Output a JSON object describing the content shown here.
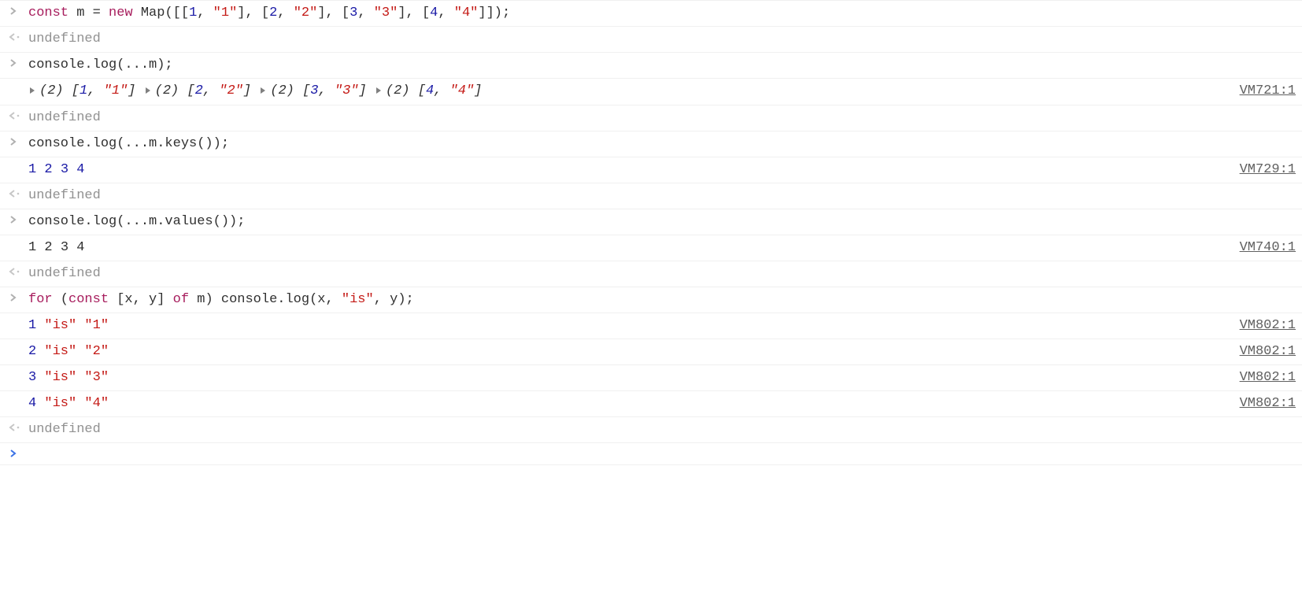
{
  "rows": [
    {
      "kind": "input",
      "code": [
        {
          "t": "const",
          "c": "kw"
        },
        {
          "t": " m "
        },
        {
          "t": "=",
          "c": ""
        },
        {
          "t": " "
        },
        {
          "t": "new",
          "c": "kw"
        },
        {
          "t": " Map([["
        },
        {
          "t": "1",
          "c": "num"
        },
        {
          "t": ", "
        },
        {
          "t": "\"1\"",
          "c": "str"
        },
        {
          "t": "], ["
        },
        {
          "t": "2",
          "c": "num"
        },
        {
          "t": ", "
        },
        {
          "t": "\"2\"",
          "c": "str"
        },
        {
          "t": "], ["
        },
        {
          "t": "3",
          "c": "num"
        },
        {
          "t": ", "
        },
        {
          "t": "\"3\"",
          "c": "str"
        },
        {
          "t": "], ["
        },
        {
          "t": "4",
          "c": "num"
        },
        {
          "t": ", "
        },
        {
          "t": "\"4\"",
          "c": "str"
        },
        {
          "t": "]]);"
        }
      ]
    },
    {
      "kind": "return",
      "code": [
        {
          "t": "undefined",
          "c": "undef"
        }
      ]
    },
    {
      "kind": "input",
      "code": [
        {
          "t": "console.log(...m);"
        }
      ]
    },
    {
      "kind": "log",
      "source": "VM721:1",
      "entries": [
        {
          "pre": "(2) ",
          "open": "[",
          "items": [
            {
              "t": "1",
              "c": "num"
            },
            {
              "t": "\"1\"",
              "c": "str"
            }
          ],
          "close": "]"
        },
        {
          "pre": "(2) ",
          "open": "[",
          "items": [
            {
              "t": "2",
              "c": "num"
            },
            {
              "t": "\"2\"",
              "c": "str"
            }
          ],
          "close": "]"
        },
        {
          "pre": "(2) ",
          "open": "[",
          "items": [
            {
              "t": "3",
              "c": "num"
            },
            {
              "t": "\"3\"",
              "c": "str"
            }
          ],
          "close": "]"
        },
        {
          "pre": "(2) ",
          "open": "[",
          "items": [
            {
              "t": "4",
              "c": "num"
            },
            {
              "t": "\"4\"",
              "c": "str"
            }
          ],
          "close": "]"
        }
      ]
    },
    {
      "kind": "return",
      "code": [
        {
          "t": "undefined",
          "c": "undef"
        }
      ]
    },
    {
      "kind": "input",
      "code": [
        {
          "t": "console.log(...m.keys());"
        }
      ]
    },
    {
      "kind": "log",
      "source": "VM729:1",
      "tokens": [
        {
          "t": "1",
          "c": "num"
        },
        {
          "t": " "
        },
        {
          "t": "2",
          "c": "num"
        },
        {
          "t": " "
        },
        {
          "t": "3",
          "c": "num"
        },
        {
          "t": " "
        },
        {
          "t": "4",
          "c": "num"
        }
      ]
    },
    {
      "kind": "return",
      "code": [
        {
          "t": "undefined",
          "c": "undef"
        }
      ]
    },
    {
      "kind": "input",
      "code": [
        {
          "t": "console.log(...m.values());"
        }
      ]
    },
    {
      "kind": "log",
      "source": "VM740:1",
      "tokens": [
        {
          "t": "1"
        },
        {
          "t": " "
        },
        {
          "t": "2"
        },
        {
          "t": " "
        },
        {
          "t": "3"
        },
        {
          "t": " "
        },
        {
          "t": "4"
        }
      ]
    },
    {
      "kind": "return",
      "code": [
        {
          "t": "undefined",
          "c": "undef"
        }
      ]
    },
    {
      "kind": "input",
      "code": [
        {
          "t": "for",
          "c": "kw"
        },
        {
          "t": " ("
        },
        {
          "t": "const",
          "c": "kw"
        },
        {
          "t": " [x, y] "
        },
        {
          "t": "of",
          "c": "kw"
        },
        {
          "t": " m) console.log(x, "
        },
        {
          "t": "\"is\"",
          "c": "str"
        },
        {
          "t": ", y);"
        }
      ]
    },
    {
      "kind": "log",
      "source": "VM802:1",
      "tokens": [
        {
          "t": "1",
          "c": "num"
        },
        {
          "t": " "
        },
        {
          "t": "\"is\"",
          "c": "str"
        },
        {
          "t": " "
        },
        {
          "t": "\"1\"",
          "c": "str"
        }
      ]
    },
    {
      "kind": "log",
      "source": "VM802:1",
      "tokens": [
        {
          "t": "2",
          "c": "num"
        },
        {
          "t": " "
        },
        {
          "t": "\"is\"",
          "c": "str"
        },
        {
          "t": " "
        },
        {
          "t": "\"2\"",
          "c": "str"
        }
      ]
    },
    {
      "kind": "log",
      "source": "VM802:1",
      "tokens": [
        {
          "t": "3",
          "c": "num"
        },
        {
          "t": " "
        },
        {
          "t": "\"is\"",
          "c": "str"
        },
        {
          "t": " "
        },
        {
          "t": "\"3\"",
          "c": "str"
        }
      ]
    },
    {
      "kind": "log",
      "source": "VM802:1",
      "tokens": [
        {
          "t": "4",
          "c": "num"
        },
        {
          "t": " "
        },
        {
          "t": "\"is\"",
          "c": "str"
        },
        {
          "t": " "
        },
        {
          "t": "\"4\"",
          "c": "str"
        }
      ]
    },
    {
      "kind": "return",
      "code": [
        {
          "t": "undefined",
          "c": "undef"
        }
      ]
    },
    {
      "kind": "prompt"
    }
  ]
}
